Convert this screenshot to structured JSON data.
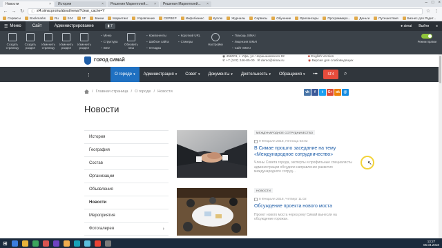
{
  "browser": {
    "tabs": [
      {
        "label": "Новости",
        "active": true
      },
      {
        "label": "История",
        "active": false
      },
      {
        "label": "Решения Маркетплей...",
        "active": false
      },
      {
        "label": "Решения Маркетплей...",
        "active": false
      }
    ],
    "url": "sf4.simai.pro/ru/about/news/?clear_cache=Y",
    "bookmarks": [
      "Сервисы",
      "Bookmarks",
      "Ru",
      "b24",
      "SF",
      "Банки",
      "Маркетинг",
      "Управление",
      "СЕРВЕР",
      "Инфобизнес",
      "Куплю",
      "Журналы",
      "Сервисы",
      "Обучение",
      "Фрилансеры",
      "Программиро...",
      "Деньги",
      "Путешествия",
      "Бизнес для Родит..."
    ]
  },
  "admin_panel": {
    "menu_label": "Меню",
    "site_label": "Сайт",
    "admin_label": "Администрирование",
    "notif_count": "7",
    "user_label": "simai",
    "logout_label": "Выйти",
    "big_tools": [
      "Создать страницу",
      "Создать раздел",
      "Изменить страницу",
      "Изменить раздел",
      "Изменить раздел",
      "Обновить кеш"
    ],
    "col1": [
      "Меню",
      "Структура",
      "SEO"
    ],
    "col2": [
      "Компоненты",
      "Шаблон сайта",
      "Отладка"
    ],
    "col3": [
      "Короткий URL",
      "Стикеры"
    ],
    "col4": [
      "Помощь SIMAI",
      "Лицензия SIMAI",
      "Сайт SIMAI"
    ],
    "settings_label": "Настройки",
    "mode_label": "Режим правки"
  },
  "site": {
    "logo_text": "ГОРОД СИМАЙ",
    "address": "456001, г. Уфа, ул. Чернышевского 82",
    "phone": "+7 (347) 246-85-00",
    "email": "demo@simai.ru",
    "english": "English Version",
    "accessibility": "Версия для слабовидящих"
  },
  "nav": {
    "items": [
      {
        "label": "О городе",
        "active": true
      },
      {
        "label": "Администрация",
        "active": false
      },
      {
        "label": "Совет",
        "active": false
      },
      {
        "label": "Документы",
        "active": false
      },
      {
        "label": "Деятельность",
        "active": false
      },
      {
        "label": "Обращения",
        "active": false
      },
      {
        "label": "•••",
        "active": false
      }
    ],
    "sf_button": "SF4"
  },
  "breadcrumbs": [
    "Главная страница",
    "О городе",
    "Новости"
  ],
  "page_title": "Новости",
  "social": [
    {
      "label": "vk",
      "color": "#4a76a8"
    },
    {
      "label": "f",
      "color": "#3b5998"
    },
    {
      "label": "t",
      "color": "#1da1f2"
    },
    {
      "label": "G+",
      "color": "#dd4b39"
    },
    {
      "label": "ok",
      "color": "#ee8208"
    },
    {
      "label": "@",
      "color": "#168de2"
    }
  ],
  "sidebar": [
    {
      "label": "История",
      "active": false,
      "chevron": false
    },
    {
      "label": "География",
      "active": false,
      "chevron": false
    },
    {
      "label": "Состав",
      "active": false,
      "chevron": false
    },
    {
      "label": "Организации",
      "active": false,
      "chevron": false
    },
    {
      "label": "Объявления",
      "active": false,
      "chevron": false
    },
    {
      "label": "Новости",
      "active": true,
      "chevron": false
    },
    {
      "label": "Мероприятия",
      "active": false,
      "chevron": false
    },
    {
      "label": "Фотогалерея",
      "active": false,
      "chevron": true
    }
  ],
  "news": [
    {
      "tag": "Международное сотрудничество",
      "date": "9 Февраля 2018, Пятница 03:02",
      "title": "В Симае прошло заседание на тему «Международное сотрудничество»",
      "desc": "Члены Совета города, эксперты и профильные специалисты администрации обсудили направление развития международного сотруд..."
    },
    {
      "tag": "Новости",
      "date": "8 Февраля 2018, Четверг 11:02",
      "title": "Обсуждение проекта нового моста",
      "desc": "Проект нового моста через реку Симай вынесли на обсуждение горожан."
    }
  ],
  "taskbar": {
    "time": "13:27",
    "date": "05.04.2018"
  },
  "colors": {
    "admin_dark": "#2a2f35",
    "nav_dark": "#30363c",
    "accent_blue": "#1f70c1",
    "link_blue": "#1f5ea8",
    "sf_red": "#e74c3c"
  }
}
